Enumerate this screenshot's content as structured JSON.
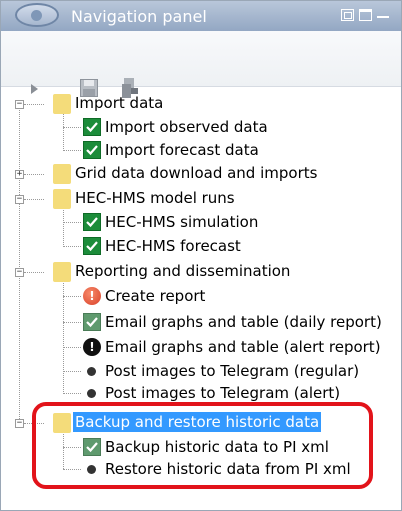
{
  "panel": {
    "title": "Navigation panel"
  },
  "toolbar": {
    "icons": [
      "play-icon",
      "save-icon",
      "export-icon"
    ]
  },
  "tree": {
    "import": {
      "label": "Import data",
      "children": [
        "Import observed data",
        "Import forecast data"
      ]
    },
    "grid": {
      "label": "Grid data download and imports"
    },
    "hec": {
      "label": "HEC-HMS model runs",
      "children": [
        "HEC-HMS simulation",
        "HEC-HMS forecast"
      ]
    },
    "reporting": {
      "label": "Reporting and dissemination",
      "children": [
        "Create report",
        "Email graphs and table (daily report)",
        "Email graphs and table (alert report)",
        "Post images to Telegram (regular)",
        "Post images to Telegram (alert)"
      ]
    },
    "backup": {
      "label": "Backup and restore historic data",
      "children": [
        "Backup historic data to PI xml",
        "Restore historic data from PI xml"
      ]
    }
  },
  "colors": {
    "highlight": "#e2131a",
    "selection": "#3399ff",
    "check": "#1c8c3a",
    "folder": "#f4dc7a"
  }
}
